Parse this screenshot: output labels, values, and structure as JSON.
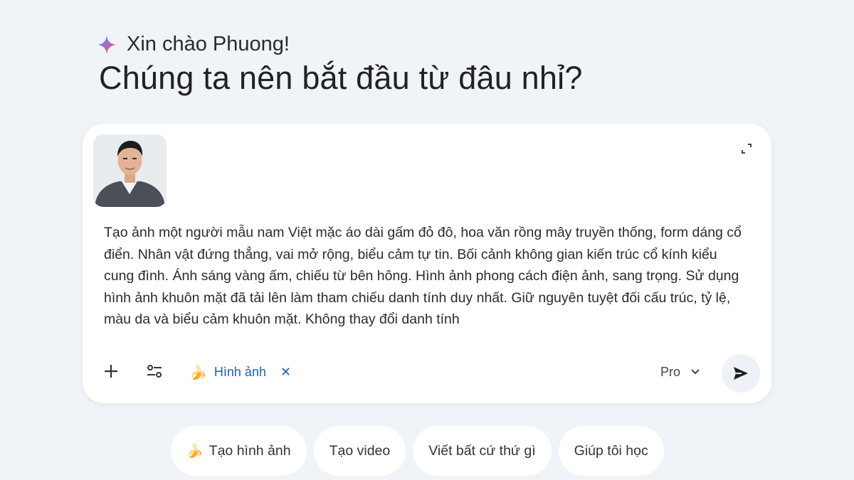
{
  "greeting": {
    "hello": "Xin chào Phuong!",
    "headline": "Chúng ta nên bắt đầu từ đâu nhỉ?"
  },
  "composer": {
    "attachment_icon": "person-photo",
    "prompt_text": "Tạo ảnh một người mẫu nam Việt mặc áo dài gấm đỏ đô, hoa văn rồng mây truyền thống, form dáng cổ điển. Nhân vật đứng thẳng, vai mở rộng, biểu cảm tự tin. Bối cảnh không gian kiến trúc cổ kính kiểu cung đình. Ánh sáng vàng ấm, chiếu từ bên hông. Hình ảnh phong cách điện ảnh, sang trọng. Sử dụng hình ảnh khuôn mặt đã tải lên làm tham chiếu danh tính duy nhất. Giữ nguyên tuyệt đối cấu trúc, tỷ lệ, màu da và biểu cảm khuôn mặt. Không thay đổi danh tính",
    "tool_chip": {
      "icon": "🍌",
      "label": "Hình ảnh",
      "close": "✕"
    },
    "model": {
      "label": "Pro"
    }
  },
  "suggestions": [
    {
      "icon": "🍌",
      "label": "Tạo hình ảnh"
    },
    {
      "icon": "",
      "label": "Tạo video"
    },
    {
      "icon": "",
      "label": "Viết bất cứ thứ gì"
    },
    {
      "icon": "",
      "label": "Giúp tôi học"
    }
  ],
  "colors": {
    "background": "#f0f3f7",
    "card": "#ffffff",
    "accent": "#1a5fc4"
  }
}
